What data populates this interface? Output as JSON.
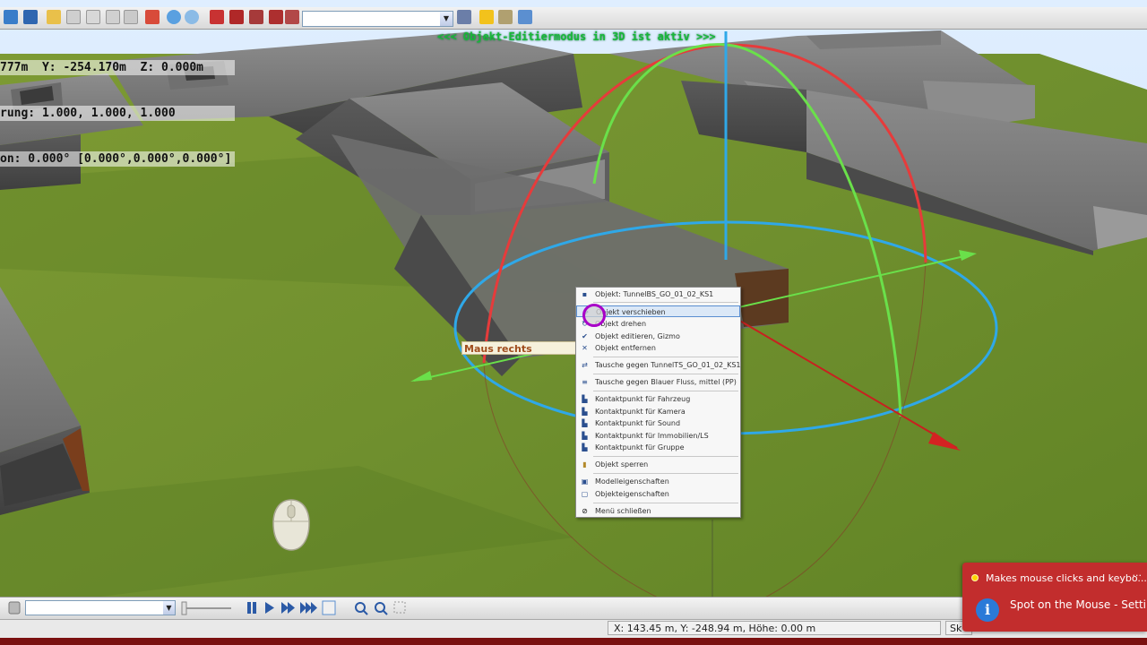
{
  "viewport": {
    "coords_lines": [
      "777m  Y: -254.170m  Z: 0.000m",
      "rung: 1.000, 1.000, 1.000",
      "on: 0.000° [0.000°,0.000°,0.000°]"
    ],
    "edit_mode_banner": "<<<  Objekt-Editiermodus in 3D ist aktiv  >>>",
    "mouse_hint": "Maus rechts"
  },
  "context_menu": {
    "items": [
      {
        "label": "Objekt: TunnelBS_GO_01_02_KS1",
        "icon": "object-icon"
      },
      {
        "label": "Objekt verschieben",
        "icon": "move-icon",
        "highlighted": true
      },
      {
        "label": "Objekt drehen",
        "icon": "rotate-icon"
      },
      {
        "label": "Objekt editieren, Gizmo",
        "icon": "check-icon"
      },
      {
        "label": "Objekt entfernen",
        "icon": "delete-icon"
      },
      {
        "label": "Tausche gegen TunnelTS_GO_01_02_KS1",
        "icon": "swap-icon"
      },
      {
        "label": "Tausche gegen Blauer Fluss, mittel (PP)",
        "icon": "swap-river-icon"
      },
      {
        "label": "Kontaktpunkt für Fahrzeug",
        "icon": "contact-vehicle-icon"
      },
      {
        "label": "Kontaktpunkt für Kamera",
        "icon": "contact-camera-icon"
      },
      {
        "label": "Kontaktpunkt für Sound",
        "icon": "contact-sound-icon"
      },
      {
        "label": "Kontaktpunkt für Immobilien/LS",
        "icon": "contact-building-icon"
      },
      {
        "label": "Kontaktpunkt für Gruppe",
        "icon": "contact-group-icon"
      },
      {
        "label": "Objekt sperren",
        "icon": "lock-icon"
      },
      {
        "label": "Modelleigenschaften",
        "icon": "model-properties-icon"
      },
      {
        "label": "Objekteigenschaften",
        "icon": "object-properties-icon"
      },
      {
        "label": "Menü schließen",
        "icon": "close-menu-icon"
      }
    ]
  },
  "statusbar": {
    "coords": "X: 143.45 m, Y: -248.94 m, Höhe: 0.00 m",
    "scale_partial": "Sk"
  },
  "notification": {
    "title": "Makes mouse clicks and keybo...",
    "more": "···",
    "message": "Spot on the Mouse - Settings",
    "info_glyph": "i"
  },
  "colors": {
    "grass": "#6a8a2c",
    "toast_bg": "#c22d2d",
    "gizmo_red": "#e63b3b",
    "gizmo_green": "#6ae04a",
    "gizmo_blue": "#2fa8e8",
    "banner_green": "#18b838"
  }
}
